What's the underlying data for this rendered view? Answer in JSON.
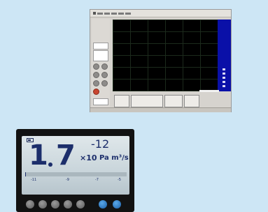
{
  "software_window": {
    "menu_items": [
      "",
      "",
      "",
      "",
      ""
    ]
  },
  "gauge": {
    "mantissa_int": "1",
    "mantissa_dec": "7",
    "exponent": "-12",
    "multiplier": "×10",
    "unit": "Pa m³/s",
    "scale_labels": [
      "-11",
      "-9",
      "-7",
      "-5"
    ],
    "bar_level": 0.01,
    "colors": {
      "display_text": "#1c2e6b",
      "device_body": "#121212",
      "blue_button": "#1a5fa8"
    }
  }
}
